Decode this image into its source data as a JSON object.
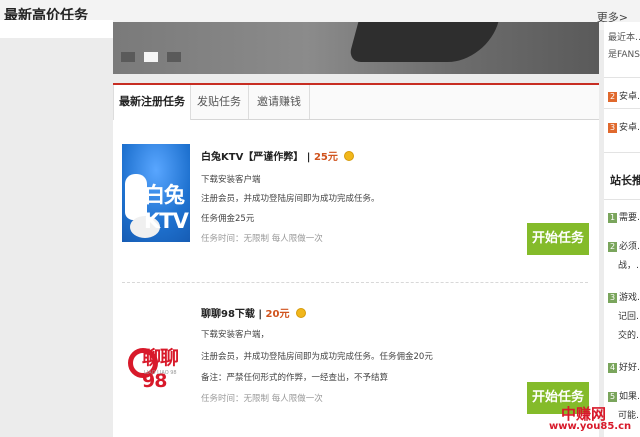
{
  "header": {
    "title": "最新高价任务",
    "more": "更多>"
  },
  "tabs": [
    "最新注册任务",
    "发贴任务",
    "邀请赚钱"
  ],
  "tasks": [
    {
      "name": "白兔KTV【严谨作弊】",
      "price": "25元",
      "lines": [
        "下载安装客户端",
        "注册会员，并成功登陆房间即为成功完成任务。",
        "任务佣金25元"
      ],
      "meta": "任务时间：无限制 每人限做一次",
      "logo_text": "白兔KTV",
      "button": "开始任务"
    },
    {
      "name": "聊聊98下载",
      "price": "20元",
      "lines": [
        "下载安装客户端，",
        "注册会员，并成功登陆房间即为成功完成任务。任务佣金20元",
        "备注：严禁任何形式的作弊，一经查出，不予结算"
      ],
      "meta": "任务时间：无限制 每人限做一次",
      "logo_text": "聊聊98",
      "logo_sub": "LIAO LIAO 98",
      "button": "开始任务"
    }
  ],
  "sidebar": {
    "top_lines": [
      "最近本…",
      "是FANS…"
    ],
    "list1": [
      {
        "num": "2",
        "text": "安卓…"
      },
      {
        "num": "3",
        "text": "安卓…"
      }
    ],
    "heading": "站长推…",
    "list2": [
      {
        "num": "1",
        "text": "需要…"
      },
      {
        "num": "2",
        "text": "必须…"
      },
      {
        "num": "",
        "text": "战，…"
      },
      {
        "num": "3",
        "text": "游戏…"
      },
      {
        "num": "",
        "text": "记回…"
      },
      {
        "num": "",
        "text": "交的…"
      },
      {
        "num": "4",
        "text": "好好…"
      },
      {
        "num": "5",
        "text": "如果…"
      },
      {
        "num": "",
        "text": "可能…"
      }
    ]
  },
  "watermark": {
    "line1": "中赚网",
    "line2": "www.you85.cn"
  }
}
